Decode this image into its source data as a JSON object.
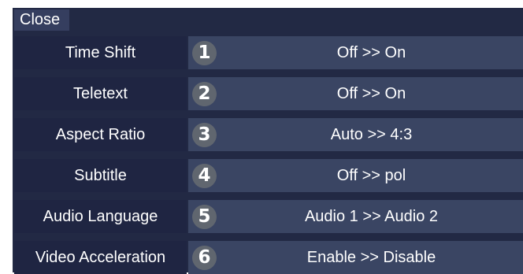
{
  "close_label": "Close",
  "rows": [
    {
      "label": "Time Shift",
      "number": "1",
      "value": "Off >> On"
    },
    {
      "label": "Teletext",
      "number": "2",
      "value": "Off >> On"
    },
    {
      "label": "Aspect Ratio",
      "number": "3",
      "value": "Auto >> 4:3"
    },
    {
      "label": "Subtitle",
      "number": "4",
      "value": "Off >> pol"
    },
    {
      "label": "Audio Language",
      "number": "5",
      "value": "Audio 1 >> Audio 2"
    },
    {
      "label": "Video Acceleration",
      "number": "6",
      "value": "Enable >> Disable"
    }
  ]
}
